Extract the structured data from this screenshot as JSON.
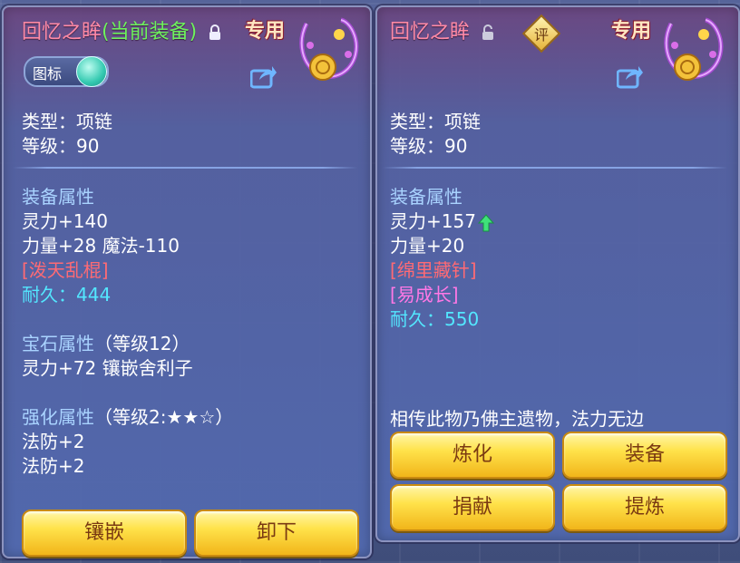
{
  "left_panel": {
    "title_name": "回忆之眸",
    "title_status": "(当前装备)",
    "special_tag": "专用",
    "toggle_label": "图标",
    "type_line": "类型：项链",
    "level_line": "等级：90",
    "equip_attr_header": "装备属性",
    "stat_1": "灵力+140",
    "stat_2": "力量+28 魔法-110",
    "special_effect": "[泼天乱棍]",
    "durability_label": "耐久：",
    "durability_value": "444",
    "gem_header": "宝石属性",
    "gem_level": "（等级12）",
    "gem_stat": "灵力+72 镶嵌舍利子",
    "enhance_header": "强化属性",
    "enhance_level": "（等级2:★★☆）",
    "enhance_stat_1": "法防+2",
    "enhance_stat_2": "法防+2",
    "buttons": {
      "inlay": "镶嵌",
      "unequip": "卸下"
    }
  },
  "right_panel": {
    "title_name": "回忆之眸",
    "review_label": "评",
    "special_tag": "专用",
    "type_line": "类型：项链",
    "level_line": "等级：90",
    "equip_attr_header": "装备属性",
    "stat_1": "灵力+157",
    "stat_2": "力量+20",
    "special_effect_1": "[绵里藏针]",
    "special_effect_2": "[易成长]",
    "durability_label": "耐久：",
    "durability_value": "550",
    "flavor_text": "相传此物乃佛主遗物，法力无边",
    "buttons": {
      "refine": "炼化",
      "equip": "装备",
      "donate": "捐献",
      "extract": "提炼"
    }
  },
  "colors": {
    "title": "#ff8aa6",
    "current": "#6ef25e",
    "section": "#a9d3ff",
    "effect_red": "#ff6a74",
    "effect_pink": "#ff78e6",
    "durability": "#53e7ff",
    "button": "#ffe24a"
  }
}
